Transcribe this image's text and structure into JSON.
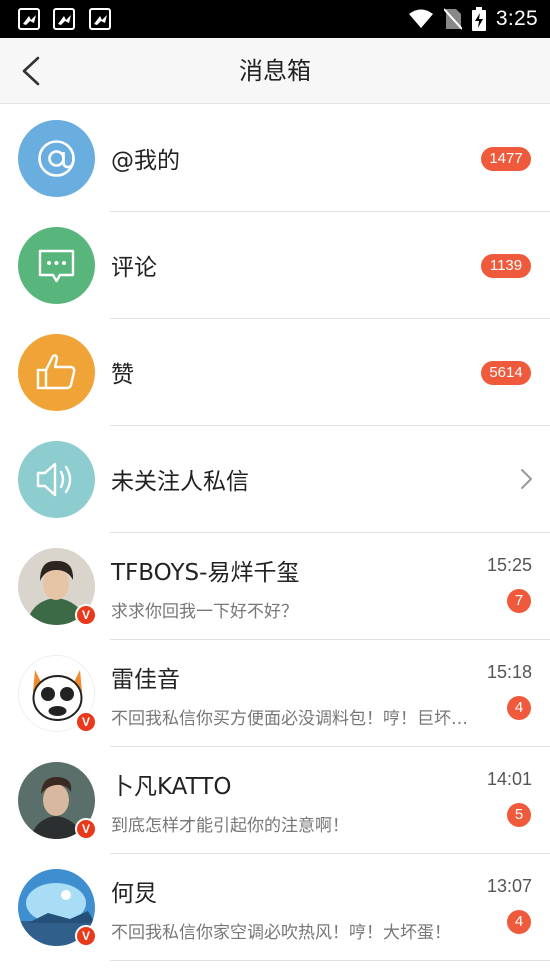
{
  "status_bar": {
    "time": "3:25",
    "notification_icons": [
      "bird-notification-icon",
      "bird-notification-icon",
      "bird-notification-icon"
    ],
    "system_icons": [
      "wifi-icon",
      "no-sim-icon",
      "battery-charging-icon"
    ]
  },
  "header": {
    "title": "消息箱",
    "back_icon": "chevron-left-icon"
  },
  "categories": [
    {
      "label": "@我的",
      "badge": "1477",
      "icon": "at-icon",
      "color": "#6aaee0"
    },
    {
      "label": "评论",
      "badge": "1139",
      "icon": "comment-bubble-icon",
      "color": "#58b67c"
    },
    {
      "label": "赞",
      "badge": "5614",
      "icon": "thumbs-up-icon",
      "color": "#f0a337"
    },
    {
      "label": "未关注人私信",
      "badge": "",
      "icon": "speaker-icon",
      "color": "#8dcdd0"
    }
  ],
  "messages": [
    {
      "name": "TFBOYS-易烊千玺",
      "time": "15:25",
      "preview": "求求你回我一下好不好？",
      "unread": "7",
      "verified": "V"
    },
    {
      "name": "雷佳音",
      "time": "15:18",
      "preview": "不回我私信你买方便面必没调料包！哼！巨坏蛋！",
      "unread": "4",
      "verified": "V"
    },
    {
      "name": "卜凡KATTO",
      "time": "14:01",
      "preview": "到底怎样才能引起你的注意啊！",
      "unread": "5",
      "verified": "V"
    },
    {
      "name": "何炅",
      "time": "13:07",
      "preview": "不回我私信你家空调必吹热风！哼！大坏蛋！",
      "unread": "4",
      "verified": "V"
    }
  ],
  "colors": {
    "badge": "#f05a3c",
    "verified": "#e8391a",
    "divider": "#e3e3e3"
  }
}
